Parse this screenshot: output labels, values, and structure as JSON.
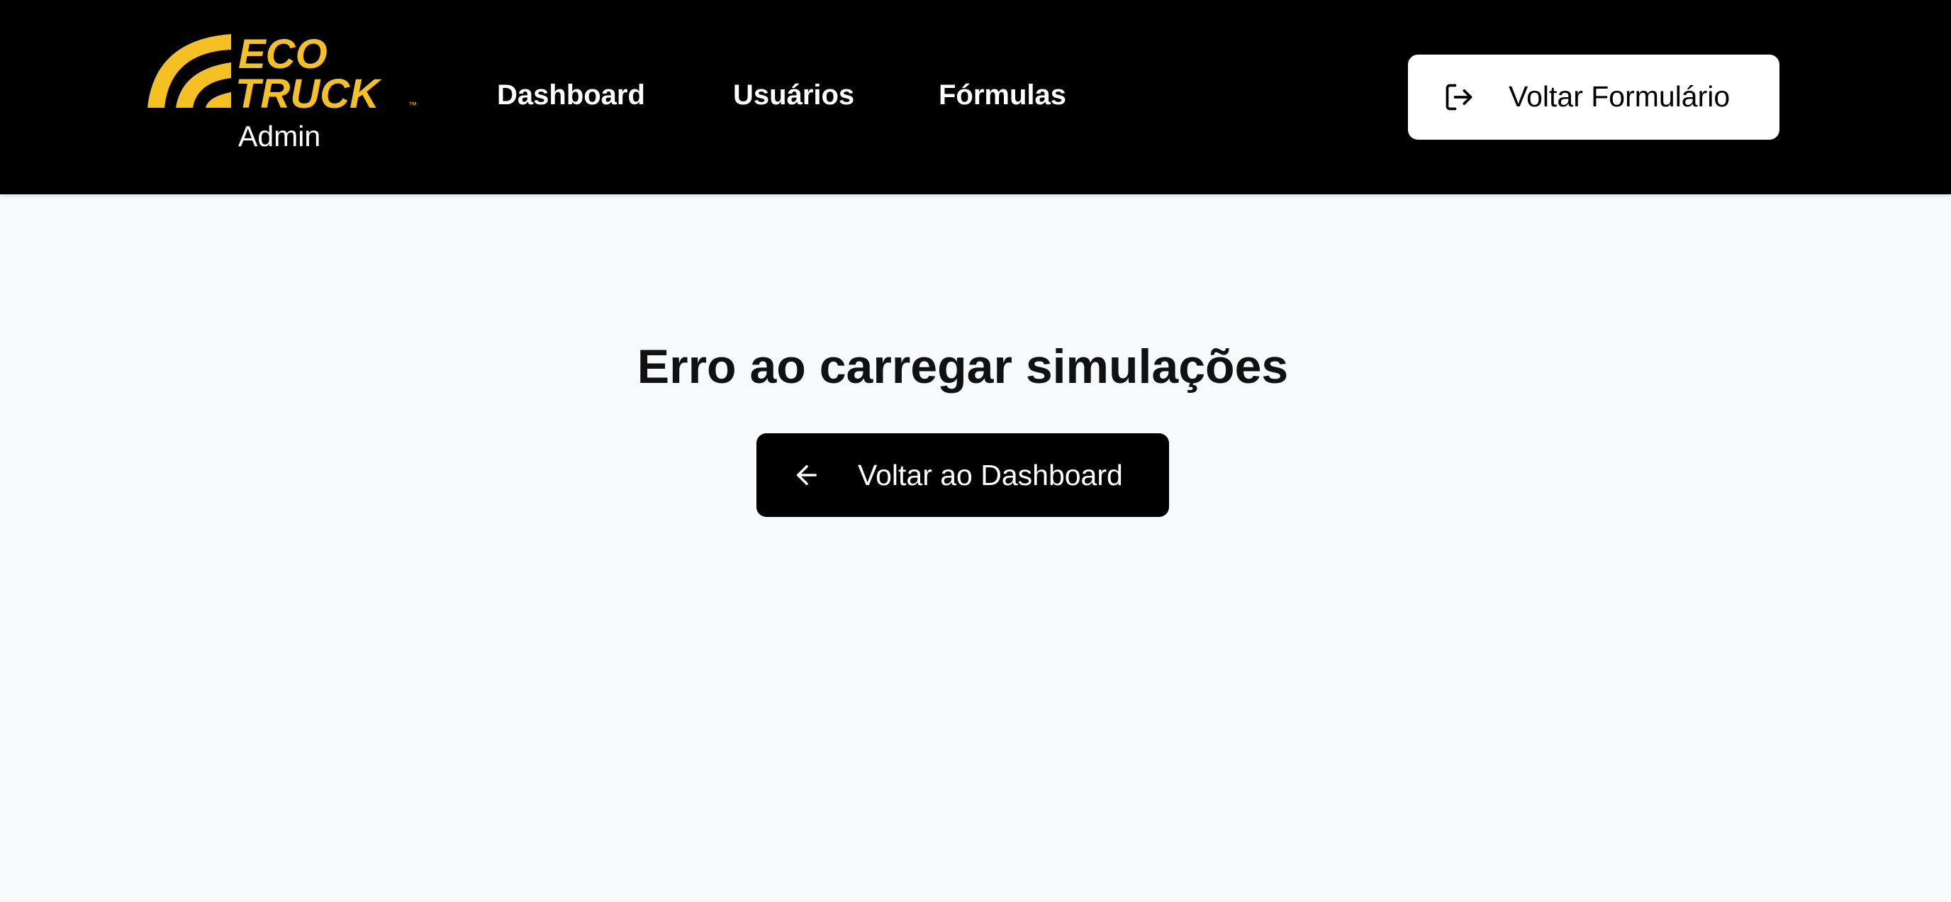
{
  "header": {
    "logo": {
      "line1": "ECO",
      "line2": "TRUCK",
      "trademark": "™",
      "subtitle": "Admin",
      "brand_color": "#f5c023"
    },
    "nav": [
      {
        "label": "Dashboard"
      },
      {
        "label": "Usuários"
      },
      {
        "label": "Fórmulas"
      }
    ],
    "back_form_button": {
      "label": "Voltar Formulário",
      "icon": "logout-arrow-icon"
    },
    "background": "#000000"
  },
  "main": {
    "error_title": "Erro ao carregar simulações",
    "back_dashboard_button": {
      "label": "Voltar ao Dashboard",
      "icon": "arrow-left-icon"
    },
    "background": "#f8f9fb"
  }
}
